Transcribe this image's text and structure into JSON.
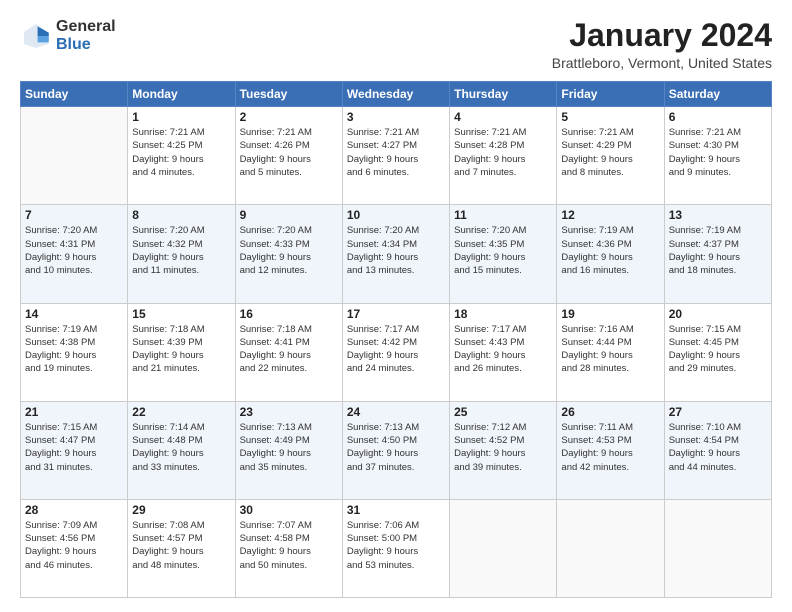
{
  "logo": {
    "general": "General",
    "blue": "Blue"
  },
  "title": {
    "month_year": "January 2024",
    "location": "Brattleboro, Vermont, United States"
  },
  "weekdays": [
    "Sunday",
    "Monday",
    "Tuesday",
    "Wednesday",
    "Thursday",
    "Friday",
    "Saturday"
  ],
  "weeks": [
    [
      {
        "day": "",
        "info": ""
      },
      {
        "day": "1",
        "info": "Sunrise: 7:21 AM\nSunset: 4:25 PM\nDaylight: 9 hours\nand 4 minutes."
      },
      {
        "day": "2",
        "info": "Sunrise: 7:21 AM\nSunset: 4:26 PM\nDaylight: 9 hours\nand 5 minutes."
      },
      {
        "day": "3",
        "info": "Sunrise: 7:21 AM\nSunset: 4:27 PM\nDaylight: 9 hours\nand 6 minutes."
      },
      {
        "day": "4",
        "info": "Sunrise: 7:21 AM\nSunset: 4:28 PM\nDaylight: 9 hours\nand 7 minutes."
      },
      {
        "day": "5",
        "info": "Sunrise: 7:21 AM\nSunset: 4:29 PM\nDaylight: 9 hours\nand 8 minutes."
      },
      {
        "day": "6",
        "info": "Sunrise: 7:21 AM\nSunset: 4:30 PM\nDaylight: 9 hours\nand 9 minutes."
      }
    ],
    [
      {
        "day": "7",
        "info": "Sunrise: 7:20 AM\nSunset: 4:31 PM\nDaylight: 9 hours\nand 10 minutes."
      },
      {
        "day": "8",
        "info": "Sunrise: 7:20 AM\nSunset: 4:32 PM\nDaylight: 9 hours\nand 11 minutes."
      },
      {
        "day": "9",
        "info": "Sunrise: 7:20 AM\nSunset: 4:33 PM\nDaylight: 9 hours\nand 12 minutes."
      },
      {
        "day": "10",
        "info": "Sunrise: 7:20 AM\nSunset: 4:34 PM\nDaylight: 9 hours\nand 13 minutes."
      },
      {
        "day": "11",
        "info": "Sunrise: 7:20 AM\nSunset: 4:35 PM\nDaylight: 9 hours\nand 15 minutes."
      },
      {
        "day": "12",
        "info": "Sunrise: 7:19 AM\nSunset: 4:36 PM\nDaylight: 9 hours\nand 16 minutes."
      },
      {
        "day": "13",
        "info": "Sunrise: 7:19 AM\nSunset: 4:37 PM\nDaylight: 9 hours\nand 18 minutes."
      }
    ],
    [
      {
        "day": "14",
        "info": "Sunrise: 7:19 AM\nSunset: 4:38 PM\nDaylight: 9 hours\nand 19 minutes."
      },
      {
        "day": "15",
        "info": "Sunrise: 7:18 AM\nSunset: 4:39 PM\nDaylight: 9 hours\nand 21 minutes."
      },
      {
        "day": "16",
        "info": "Sunrise: 7:18 AM\nSunset: 4:41 PM\nDaylight: 9 hours\nand 22 minutes."
      },
      {
        "day": "17",
        "info": "Sunrise: 7:17 AM\nSunset: 4:42 PM\nDaylight: 9 hours\nand 24 minutes."
      },
      {
        "day": "18",
        "info": "Sunrise: 7:17 AM\nSunset: 4:43 PM\nDaylight: 9 hours\nand 26 minutes."
      },
      {
        "day": "19",
        "info": "Sunrise: 7:16 AM\nSunset: 4:44 PM\nDaylight: 9 hours\nand 28 minutes."
      },
      {
        "day": "20",
        "info": "Sunrise: 7:15 AM\nSunset: 4:45 PM\nDaylight: 9 hours\nand 29 minutes."
      }
    ],
    [
      {
        "day": "21",
        "info": "Sunrise: 7:15 AM\nSunset: 4:47 PM\nDaylight: 9 hours\nand 31 minutes."
      },
      {
        "day": "22",
        "info": "Sunrise: 7:14 AM\nSunset: 4:48 PM\nDaylight: 9 hours\nand 33 minutes."
      },
      {
        "day": "23",
        "info": "Sunrise: 7:13 AM\nSunset: 4:49 PM\nDaylight: 9 hours\nand 35 minutes."
      },
      {
        "day": "24",
        "info": "Sunrise: 7:13 AM\nSunset: 4:50 PM\nDaylight: 9 hours\nand 37 minutes."
      },
      {
        "day": "25",
        "info": "Sunrise: 7:12 AM\nSunset: 4:52 PM\nDaylight: 9 hours\nand 39 minutes."
      },
      {
        "day": "26",
        "info": "Sunrise: 7:11 AM\nSunset: 4:53 PM\nDaylight: 9 hours\nand 42 minutes."
      },
      {
        "day": "27",
        "info": "Sunrise: 7:10 AM\nSunset: 4:54 PM\nDaylight: 9 hours\nand 44 minutes."
      }
    ],
    [
      {
        "day": "28",
        "info": "Sunrise: 7:09 AM\nSunset: 4:56 PM\nDaylight: 9 hours\nand 46 minutes."
      },
      {
        "day": "29",
        "info": "Sunrise: 7:08 AM\nSunset: 4:57 PM\nDaylight: 9 hours\nand 48 minutes."
      },
      {
        "day": "30",
        "info": "Sunrise: 7:07 AM\nSunset: 4:58 PM\nDaylight: 9 hours\nand 50 minutes."
      },
      {
        "day": "31",
        "info": "Sunrise: 7:06 AM\nSunset: 5:00 PM\nDaylight: 9 hours\nand 53 minutes."
      },
      {
        "day": "",
        "info": ""
      },
      {
        "day": "",
        "info": ""
      },
      {
        "day": "",
        "info": ""
      }
    ]
  ]
}
